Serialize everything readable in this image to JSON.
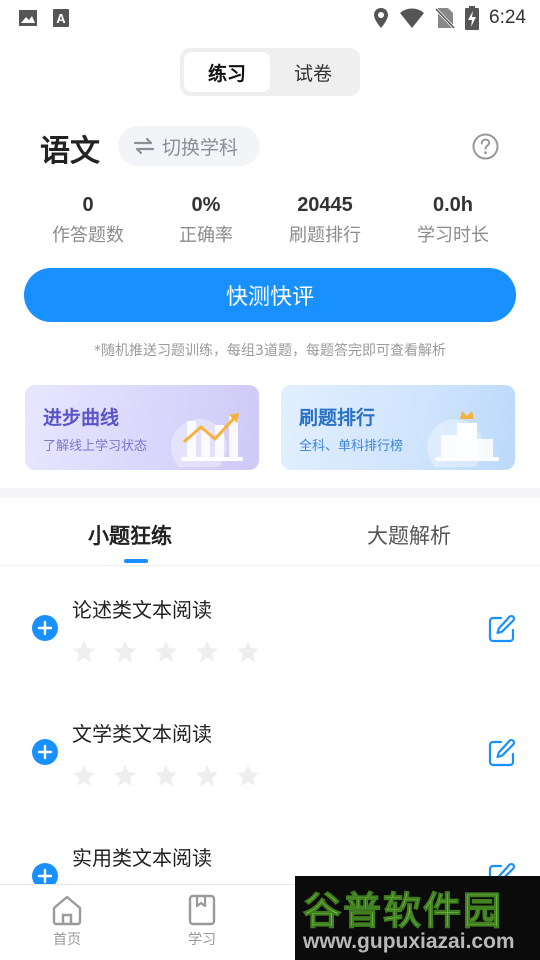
{
  "statusbar": {
    "time": "6:24",
    "icons": [
      "image-icon",
      "text-a-icon",
      "location-icon",
      "wifi-icon",
      "no-sim-icon",
      "battery-charging-icon"
    ]
  },
  "segment": {
    "tabs": [
      "练习",
      "试卷"
    ],
    "active_index": 0
  },
  "subject": {
    "name": "语文",
    "switch_label": "切换学科"
  },
  "stats": [
    {
      "value": "0",
      "label": "作答题数"
    },
    {
      "value": "0%",
      "label": "正确率"
    },
    {
      "value": "20445",
      "label": "刷题排行"
    },
    {
      "value": "0.0h",
      "label": "学习时长"
    }
  ],
  "quick_test": {
    "label": "快测快评",
    "hint": "*随机推送习题训练，每组3道题，每题答完即可查看解析"
  },
  "cards": {
    "progress": {
      "title": "进步曲线",
      "subtitle": "了解线上学习状态"
    },
    "rank": {
      "title": "刷题排行",
      "subtitle": "全科、单科排行榜"
    }
  },
  "tabs": {
    "items": [
      "小题狂练",
      "大题解析"
    ],
    "active_index": 0
  },
  "list": [
    {
      "title": "论述类文本阅读",
      "stars": 0,
      "max_stars": 5
    },
    {
      "title": "文学类文本阅读",
      "stars": 0,
      "max_stars": 5
    },
    {
      "title": "实用类文本阅读",
      "stars": 0,
      "max_stars": 5
    }
  ],
  "bottomnav": [
    {
      "label": "首页",
      "icon": "home-icon"
    },
    {
      "label": "学习",
      "icon": "book-icon"
    }
  ],
  "watermark": {
    "name": "谷普软件园",
    "url": "www.gupuxiazai.com"
  },
  "colors": {
    "accent": "#1890ff",
    "star_empty": "#eeeeee"
  }
}
